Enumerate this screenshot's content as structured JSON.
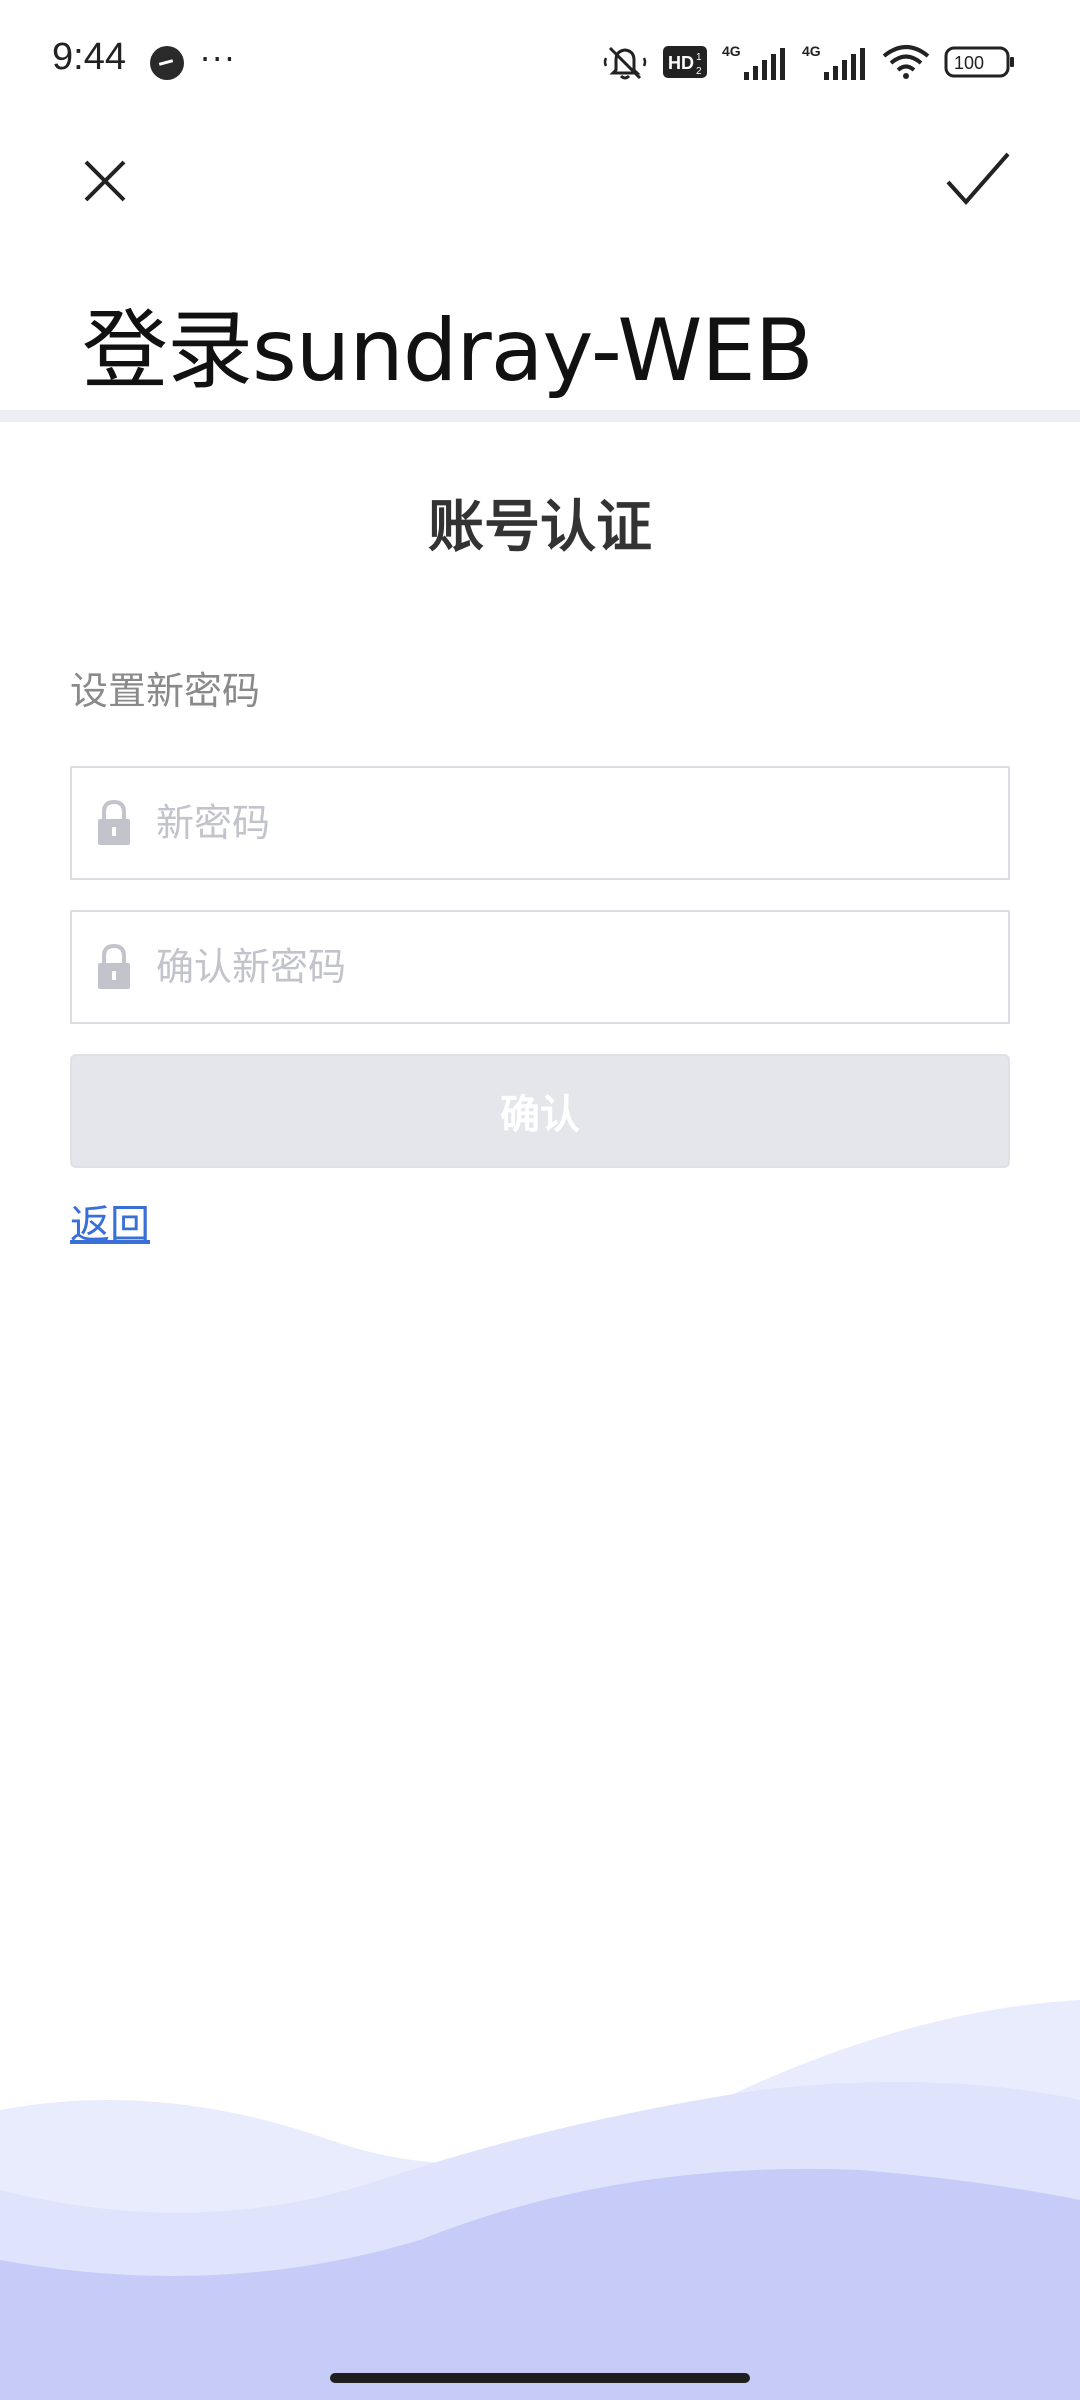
{
  "status_bar": {
    "time": "9:44",
    "more": "···",
    "network_1": "4G",
    "network_2": "4G",
    "hd_label": "HD",
    "battery": "100"
  },
  "header": {
    "title": "登录sundray-WEB"
  },
  "auth": {
    "title": "账号认证",
    "section_label": "设置新密码",
    "new_password": {
      "value": "",
      "placeholder": "新密码"
    },
    "confirm_password": {
      "value": "",
      "placeholder": "确认新密码"
    },
    "confirm_button": "确认",
    "back_link": "返回"
  },
  "colors": {
    "link": "#3a6fd8",
    "button_disabled": "#e5e6ec",
    "wave_light": "#dfe3fb",
    "wave_dark": "#c6ccf7"
  }
}
